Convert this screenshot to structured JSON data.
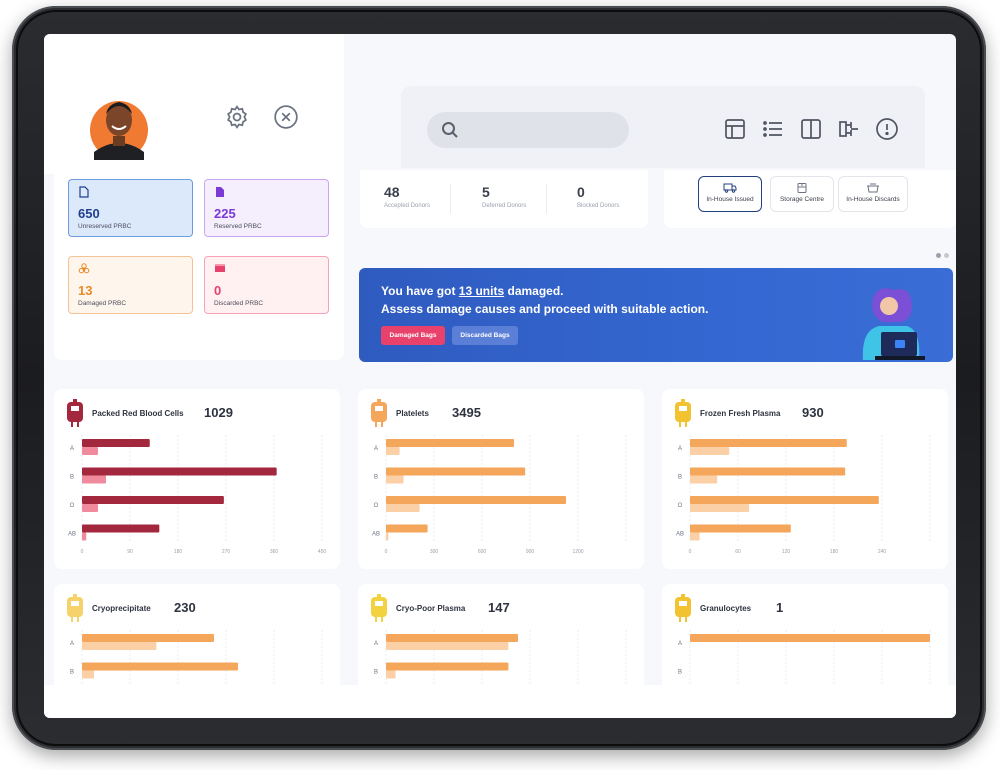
{
  "stats": [
    {
      "value": "650",
      "label": "Unreserved PRBC",
      "color": "#1f3f8f",
      "bg": "#dbe9fb",
      "border": "#6b9ce0",
      "icon": "document-icon"
    },
    {
      "value": "225",
      "label": "Reserved PRBC",
      "color": "#7b39d6",
      "bg": "#f4eefd",
      "border": "#c7a7ef",
      "icon": "document-icon"
    },
    {
      "value": "13",
      "label": "Damaged PRBC",
      "color": "#e98a2a",
      "bg": "#fef5ec",
      "border": "#f3c396",
      "icon": "biohazard-icon"
    },
    {
      "value": "0",
      "label": "Discarded PRBC",
      "color": "#e8416b",
      "bg": "#fff0f2",
      "border": "#f5a4b7",
      "icon": "discard-bin-icon"
    }
  ],
  "donors": [
    {
      "value": "48",
      "label": "Accepted Donors"
    },
    {
      "value": "5",
      "label": "Deferred Donors"
    },
    {
      "value": "0",
      "label": "Blocked Donors"
    }
  ],
  "issue_tabs": [
    {
      "label": "In-House Issued",
      "icon": "truck-icon",
      "active": true
    },
    {
      "label": "Storage Centre",
      "icon": "storage-icon",
      "active": false
    },
    {
      "label": "In-House Discards",
      "icon": "discard-icon",
      "active": false
    }
  ],
  "banner": {
    "line1_pre": "You have got ",
    "line1_units": "13 units",
    "line1_post": " damaged.",
    "line2": "Assess damage causes and proceed with suitable action.",
    "btn_damaged": "Damaged Bags",
    "btn_discarded": "Discarded Bags"
  },
  "chart_data": [
    {
      "type": "bar",
      "title": "Packed Red Blood Cells",
      "total": "1029",
      "categories": [
        "A",
        "B",
        "O",
        "AB"
      ],
      "xlim": [
        0,
        450
      ],
      "xticks": [
        "0",
        "90",
        "180",
        "270",
        "360",
        "450"
      ],
      "series": [
        {
          "values": [
            127,
            365,
            266,
            145
          ],
          "color": "#a3283e"
        },
        {
          "values": [
            30,
            45,
            30,
            8
          ],
          "color": "#f08b9d"
        }
      ]
    },
    {
      "type": "bar",
      "title": "Platelets",
      "total": "3495",
      "categories": [
        "A",
        "B",
        "O",
        "AB"
      ],
      "xlim": [
        0,
        1500
      ],
      "xticks": [
        "0",
        "300",
        "600",
        "900",
        "1200"
      ],
      "series": [
        {
          "values": [
            800,
            870,
            1125,
            260
          ],
          "color": "#f4a75a"
        },
        {
          "values": [
            85,
            110,
            210,
            15
          ],
          "color": "#fbd0a7"
        }
      ]
    },
    {
      "type": "bar",
      "title": "Frozen Fresh Plasma",
      "total": "930",
      "categories": [
        "A",
        "B",
        "O",
        "AB"
      ],
      "xlim": [
        0,
        300
      ],
      "xticks": [
        "0",
        "60",
        "120",
        "180",
        "240"
      ],
      "series": [
        {
          "values": [
            196,
            194,
            236,
            126
          ],
          "color": "#f4a75a"
        },
        {
          "values": [
            49,
            34,
            74,
            12
          ],
          "color": "#fbd0a7"
        }
      ]
    },
    {
      "type": "bar",
      "title": "Cryoprecipitate",
      "total": "230",
      "categories": [
        "A",
        "B"
      ],
      "xlim": [
        0,
        100
      ],
      "xticks": [],
      "series": [
        {
          "values": [
            55,
            65
          ],
          "color": "#f4a75a"
        },
        {
          "values": [
            31,
            5
          ],
          "color": "#fbd0a7"
        }
      ]
    },
    {
      "type": "bar",
      "title": "Cryo-Poor Plasma",
      "total": "147",
      "categories": [
        "A",
        "B"
      ],
      "xlim": [
        0,
        100
      ],
      "xticks": [],
      "series": [
        {
          "values": [
            55,
            51
          ],
          "color": "#f4a75a"
        },
        {
          "values": [
            51,
            4
          ],
          "color": "#fbd0a7"
        }
      ]
    },
    {
      "type": "bar",
      "title": "Granulocytes",
      "total": "1",
      "categories": [
        "A",
        "B"
      ],
      "xlim": [
        0,
        1
      ],
      "xticks": [],
      "series": [
        {
          "values": [
            1,
            0
          ],
          "color": "#f4a75a"
        },
        {
          "values": [
            0,
            0
          ],
          "color": "#fbd0a7"
        }
      ]
    }
  ]
}
